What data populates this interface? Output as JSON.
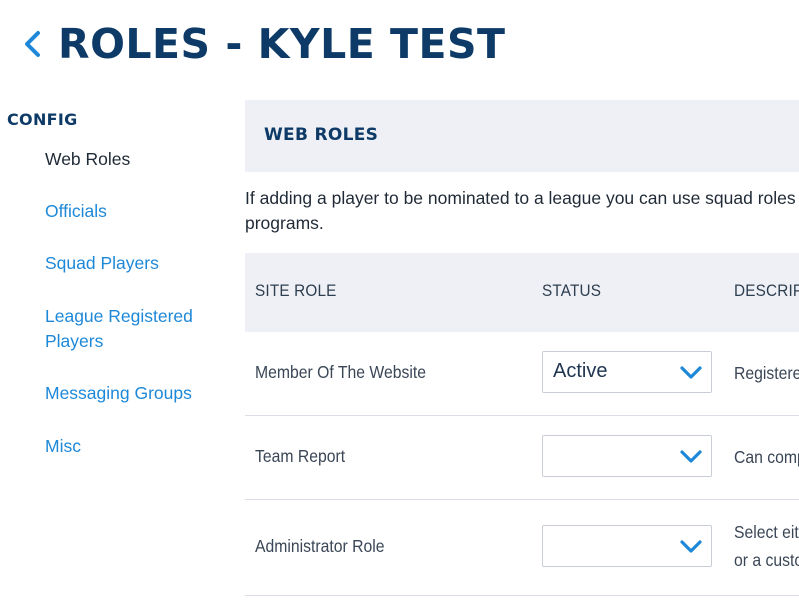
{
  "header": {
    "title": "ROLES - KYLE TEST",
    "back_icon": "chevron-left-icon"
  },
  "sidebar": {
    "heading": "CONFIG",
    "items": [
      {
        "label": "Web Roles",
        "active": true
      },
      {
        "label": "Officials",
        "active": false
      },
      {
        "label": "Squad Players",
        "active": false
      },
      {
        "label": "League Registered Players",
        "active": false
      },
      {
        "label": "Messaging Groups",
        "active": false
      },
      {
        "label": "Misc",
        "active": false
      }
    ]
  },
  "main": {
    "section_title": "WEB ROLES",
    "intro_line1": "If adding a player to be nominated to a league you can use squad roles s",
    "intro_line2": "programs.",
    "table": {
      "columns": [
        "SITE ROLE",
        "STATUS",
        "DESCRIPT"
      ],
      "rows": [
        {
          "role": "Member Of The Website",
          "status": "Active",
          "desc_line1": "Registere",
          "desc_line2": ""
        },
        {
          "role": "Team Report",
          "status": "",
          "desc_line1": "Can comp",
          "desc_line2": ""
        },
        {
          "role": "Administrator Role",
          "status": "",
          "desc_line1": "Select eit",
          "desc_line2": "or a custo"
        }
      ]
    }
  },
  "colors": {
    "title": "#0d3a66",
    "link": "#1e88d8",
    "header_bg": "#eef0f5",
    "chevron": "#1e88d8"
  }
}
